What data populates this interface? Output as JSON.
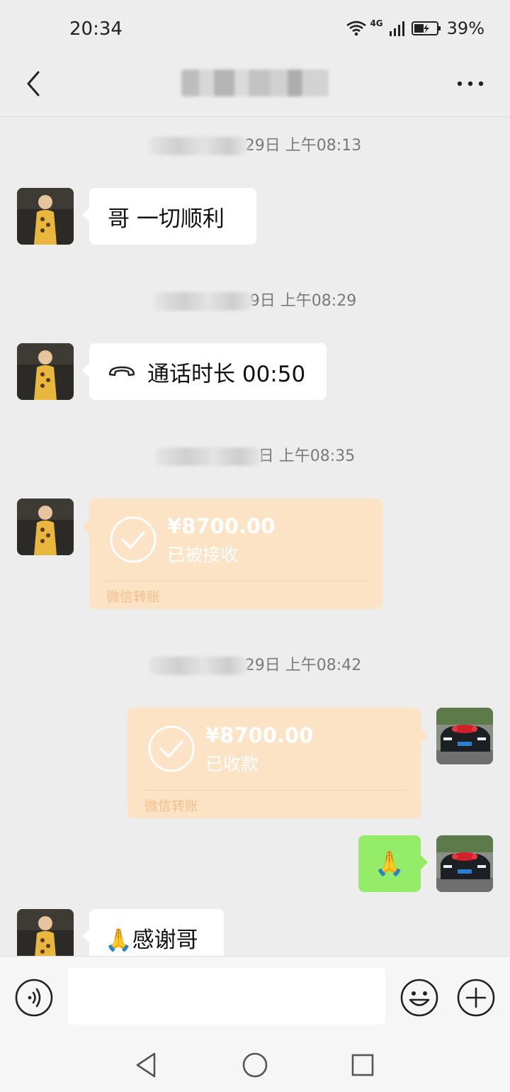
{
  "status_bar": {
    "time": "20:34",
    "network": "4G",
    "battery": "39%"
  },
  "header": {
    "title": "████████",
    "back_icon": "chevron-left-icon",
    "more_icon": "ellipsis-icon"
  },
  "messages": [
    {
      "type": "timestamp",
      "text": "29日 上午08:13"
    },
    {
      "type": "text",
      "side": "left",
      "text": "哥 一切顺利"
    },
    {
      "type": "timestamp",
      "text": "9日 上午08:29"
    },
    {
      "type": "call",
      "side": "left",
      "text": "通话时长 00:50"
    },
    {
      "type": "timestamp",
      "text": "日 上午08:35"
    },
    {
      "type": "transfer",
      "side": "left",
      "amount": "¥8700.00",
      "status": "已被接收",
      "footer": "微信转账"
    },
    {
      "type": "timestamp",
      "text": "29日 上午08:42"
    },
    {
      "type": "transfer",
      "side": "right",
      "amount": "¥8700.00",
      "status": "已收款",
      "footer": "微信转账"
    },
    {
      "type": "emoji",
      "side": "right",
      "text": "🙏"
    },
    {
      "type": "text",
      "side": "left",
      "text": "🙏感谢哥"
    }
  ],
  "input_bar": {
    "placeholder": "",
    "voice_icon": "voice-icon",
    "emoji_icon": "emoji-icon",
    "plus_icon": "plus-icon"
  },
  "nav_bar": {
    "back_icon": "nav-back-icon",
    "home_icon": "nav-home-icon",
    "recents_icon": "nav-recents-icon"
  },
  "colors": {
    "background": "#ededed",
    "bubble_green": "#95ec69",
    "transfer_bg": "#fde3c5"
  }
}
